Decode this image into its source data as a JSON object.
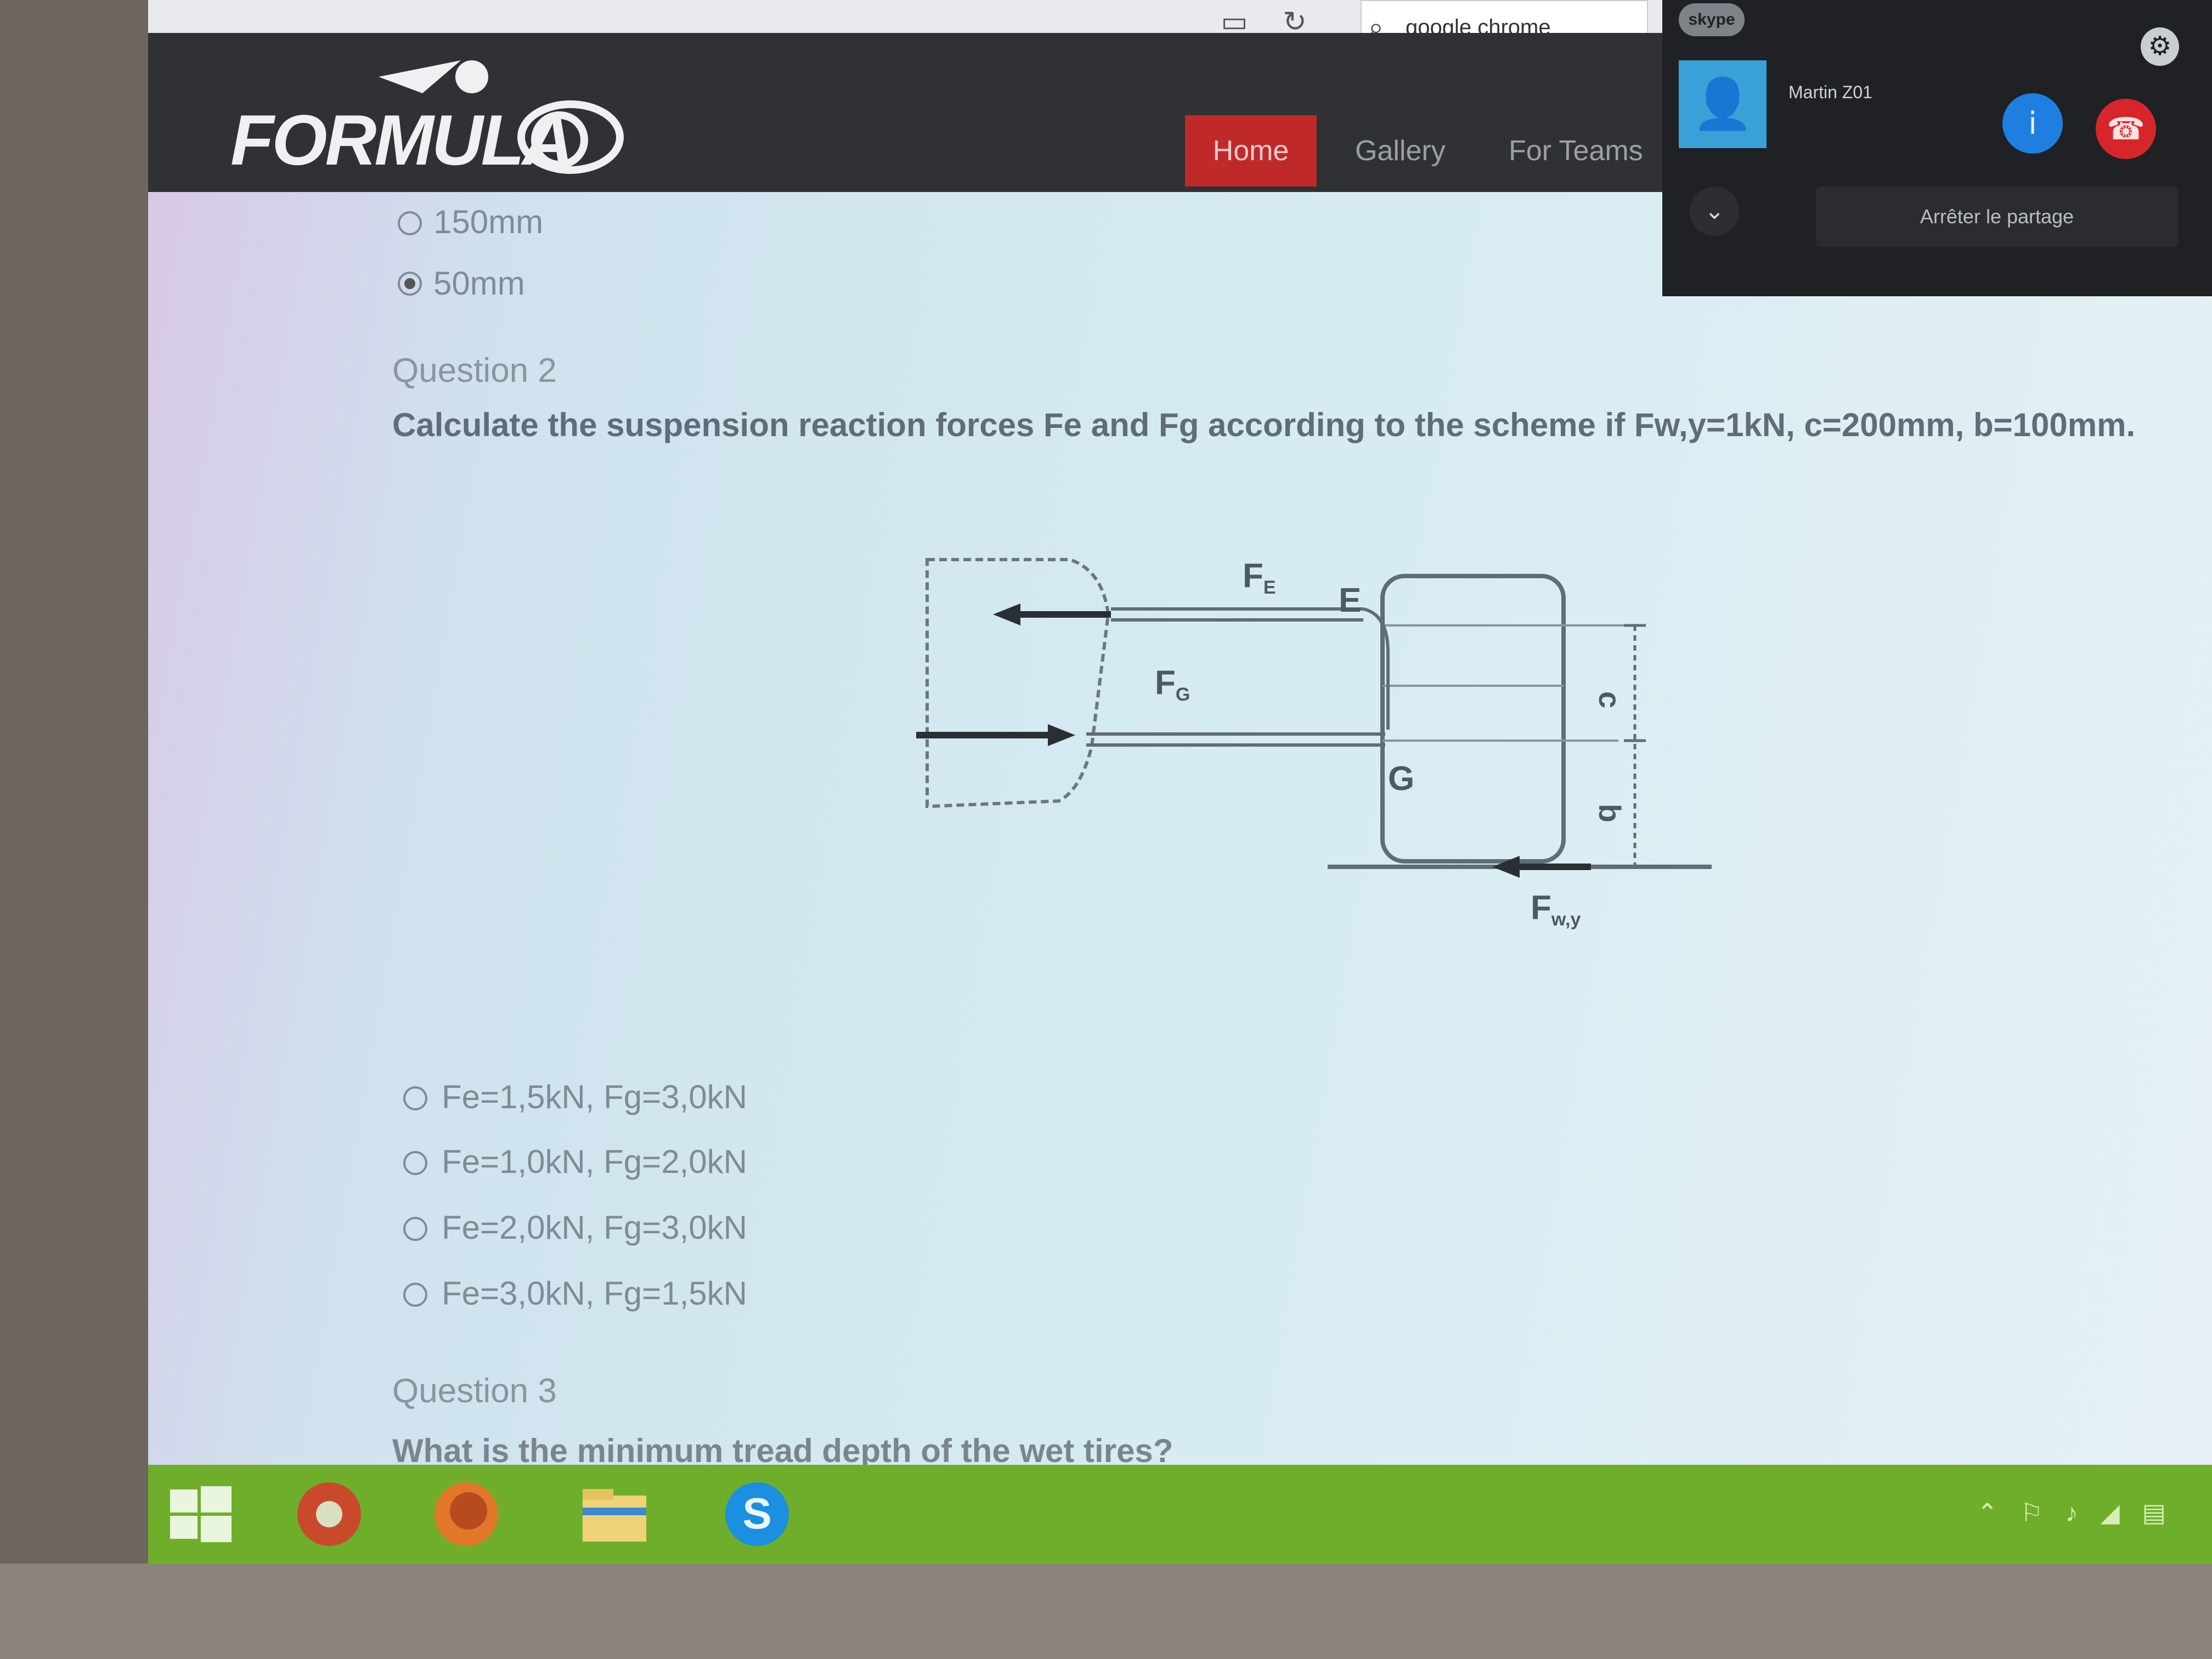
{
  "browser": {
    "search_value": "google chrome"
  },
  "header": {
    "logo_text": "FORMULA",
    "nav": [
      {
        "label": "Home"
      },
      {
        "label": "Gallery"
      },
      {
        "label": "For Teams"
      }
    ]
  },
  "skype": {
    "logo": "skype",
    "caller_name": "Martin Z01",
    "stop_sharing": "Arrêter le partage"
  },
  "question1": {
    "options": [
      {
        "label": "150mm",
        "selected": false
      },
      {
        "label": "50mm",
        "selected": true
      }
    ]
  },
  "question2": {
    "label": "Question 2",
    "text": "Calculate the suspension reaction forces Fe and Fg according to the scheme if Fw,y=1kN, c=200mm, b=100mm.",
    "diagram_labels": {
      "fe": "F",
      "fe_sub": "E",
      "e": "E",
      "fg": "F",
      "fg_sub": "G",
      "g": "G",
      "c": "c",
      "b": "b",
      "fwy": "F",
      "fwy_sub": "w,y"
    },
    "options": [
      {
        "label": "Fe=1,5kN, Fg=3,0kN",
        "selected": false
      },
      {
        "label": "Fe=1,0kN, Fg=2,0kN",
        "selected": false
      },
      {
        "label": "Fe=2,0kN, Fg=3,0kN",
        "selected": false
      },
      {
        "label": "Fe=3,0kN, Fg=1,5kN",
        "selected": false
      }
    ]
  },
  "question3": {
    "label": "Question 3",
    "text": "What is the minimum tread depth of the wet tires?"
  },
  "taskbar": {
    "apps": [
      "start-icon",
      "chrome-icon",
      "firefox-icon",
      "file-explorer-icon",
      "skype-icon"
    ]
  }
}
